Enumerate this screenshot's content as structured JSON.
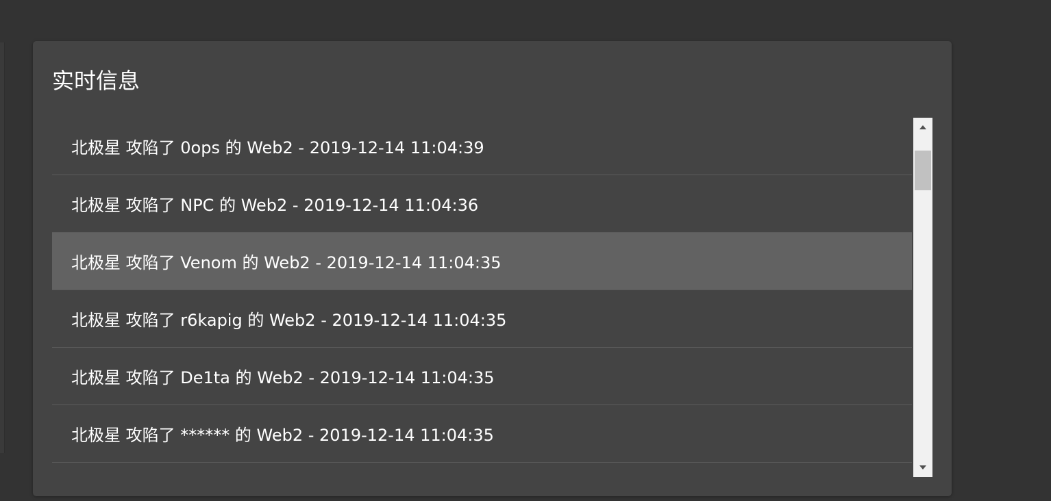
{
  "panel": {
    "title": "实时信息"
  },
  "feed": {
    "items": [
      {
        "text": "北极星 攻陷了 0ops 的 Web2 - 2019-12-14 11:04:39"
      },
      {
        "text": "北极星 攻陷了 NPC 的 Web2 - 2019-12-14 11:04:36"
      },
      {
        "text": "北极星 攻陷了 Venom 的 Web2 - 2019-12-14 11:04:35"
      },
      {
        "text": "北极星 攻陷了 r6kapig 的 Web2 - 2019-12-14 11:04:35"
      },
      {
        "text": "北极星 攻陷了 De1ta 的 Web2 - 2019-12-14 11:04:35"
      },
      {
        "text": "北极星 攻陷了 ****** 的 Web2 - 2019-12-14 11:04:35"
      }
    ]
  },
  "colors": {
    "page_background": "#333333",
    "card_background": "#444444",
    "row_highlight": "#626262",
    "row_divider": "#5c5c5c",
    "text": "#ffffff",
    "scrollbar_track": "#f1f1f1",
    "scrollbar_thumb": "#c1c1c1"
  },
  "icons": {
    "scroll_up": "triangle-up-icon",
    "scroll_down": "triangle-down-icon"
  }
}
